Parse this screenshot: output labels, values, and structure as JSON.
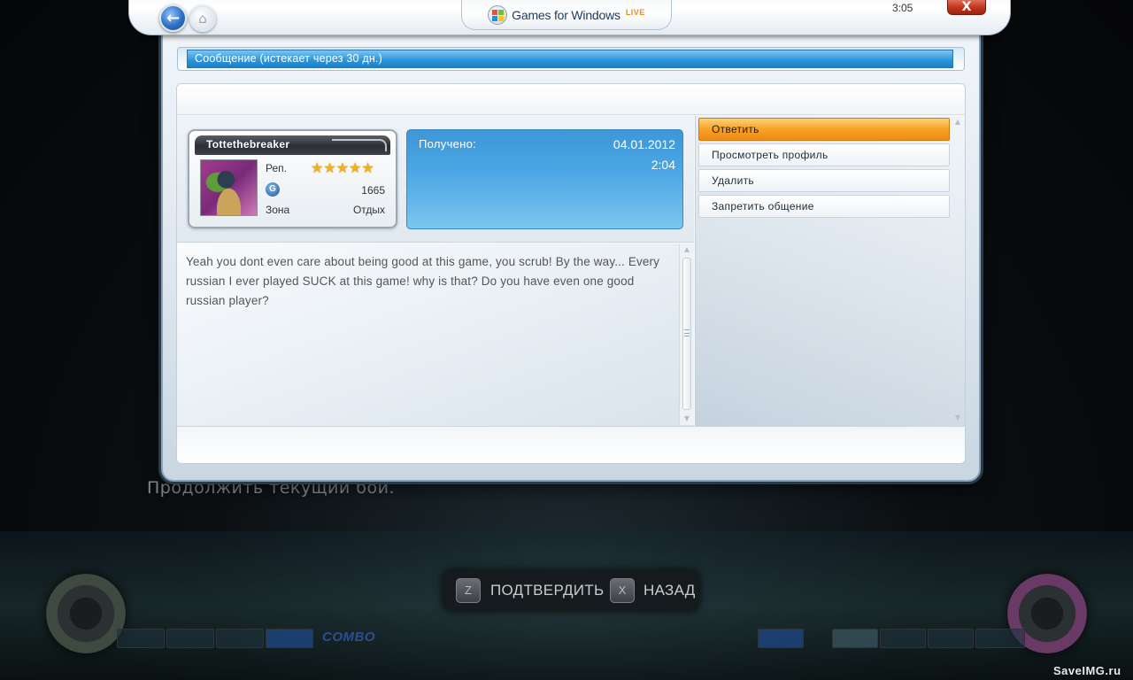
{
  "app": {
    "logo_text": "Games for Windows",
    "logo_live": "LIVE",
    "clock": "3:05",
    "close_glyph": "X"
  },
  "title_bar": {
    "text": "Сообщение (истекает через 30 дн.)"
  },
  "gamer_card": {
    "gamertag": "Tottethebreaker",
    "rep_label": "Реп.",
    "rep_stars": 5,
    "gamerscore_icon": "G",
    "gamerscore": "1665",
    "zone_label": "Зона",
    "zone_value": "Отдых"
  },
  "received": {
    "label": "Получено:",
    "date": "04.01.2012",
    "time": "2:04"
  },
  "message": {
    "body": "Yeah you dont even care about being good at this game, you scrub! By the way... Every russian I ever played SUCK at this game! why is that? Do you have even one good russian player?"
  },
  "actions": [
    {
      "label": "Ответить",
      "selected": true
    },
    {
      "label": "Просмотреть профиль",
      "selected": false
    },
    {
      "label": "Удалить",
      "selected": false
    },
    {
      "label": "Запретить общение",
      "selected": false
    }
  ],
  "game": {
    "continue_text": "Продолжить текущий бой.",
    "confirm_key": "Z",
    "confirm_label": "ПОДТВЕРДИТЬ",
    "back_key": "X",
    "back_label": "НАЗАД",
    "combo_label": "COMBO"
  },
  "watermark": "SaveIMG.ru",
  "icons": {
    "back": "back-arrow-icon",
    "home": "home-icon",
    "windows_logo": "windows-flag-icon",
    "gamerscore": "gamerscore-icon",
    "star": "star-icon"
  },
  "colors": {
    "accent_blue": "#2f97dc",
    "selected_orange": "#f7a52a",
    "close_red": "#c2351c"
  }
}
